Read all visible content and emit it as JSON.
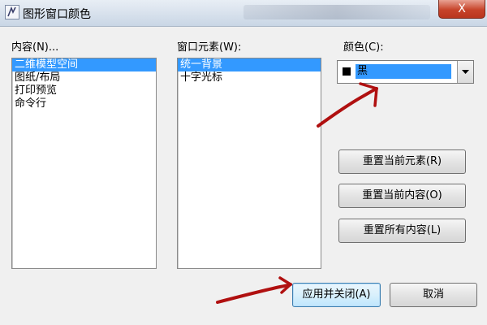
{
  "window": {
    "title": "图形窗口颜色",
    "close_symbol": "X",
    "app_icon": "pen-icon"
  },
  "context_list": {
    "label": "内容(N)...",
    "items": [
      "二维模型空间",
      "图纸/布局",
      "打印预览",
      "命令行"
    ],
    "selected_index": 0
  },
  "element_list": {
    "label": "窗口元素(W):",
    "items": [
      "统一背景",
      "十字光标"
    ],
    "selected_index": 0
  },
  "color": {
    "label": "颜色(C):",
    "value": "黑",
    "swatch_color": "#000000",
    "dropdown_icon": "chevron-down-icon"
  },
  "buttons": {
    "restore_element": "重置当前元素(R)",
    "restore_context": "重置当前内容(O)",
    "restore_all": "重置所有内容(L)",
    "apply_close": "应用并关闭(A)",
    "cancel": "取消"
  },
  "annotation": {
    "color": "#b01010"
  }
}
